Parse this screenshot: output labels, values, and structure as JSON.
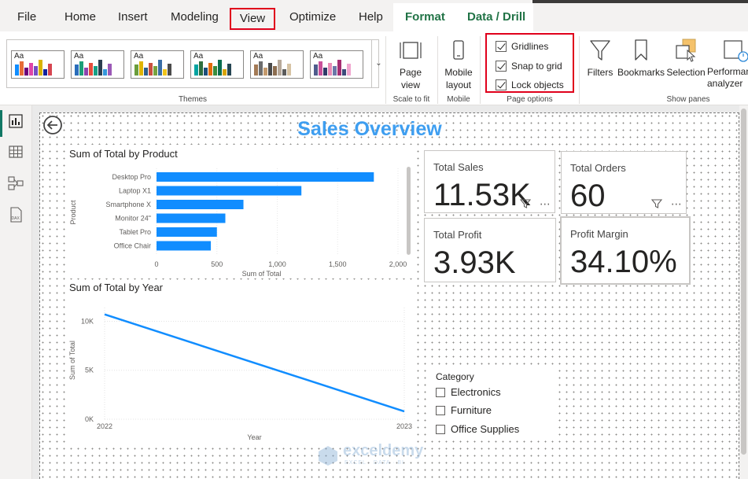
{
  "menu": {
    "file": "File",
    "home": "Home",
    "insert": "Insert",
    "modeling": "Modeling",
    "view": "View",
    "optimize": "Optimize",
    "help": "Help",
    "format": "Format",
    "data_drill": "Data / Drill"
  },
  "ribbon": {
    "themes_label": "Themes",
    "theme_sample": "Aa",
    "themes": [
      {
        "colors": [
          "#118dff",
          "#e66c37",
          "#6b007b",
          "#e044a7",
          "#744ec2",
          "#d9b300",
          "#12239e",
          "#d64550"
        ]
      },
      {
        "colors": [
          "#2a6ebb",
          "#1b9e77",
          "#8e44ad",
          "#e74c3c",
          "#16a085",
          "#2c3e50",
          "#3498db",
          "#9b59b6"
        ]
      },
      {
        "colors": [
          "#6b9e3c",
          "#e0b400",
          "#2d5f8b",
          "#c94f3f",
          "#77a33f",
          "#3a6ea5",
          "#f0c419",
          "#4b4b4b"
        ]
      },
      {
        "colors": [
          "#00a3a1",
          "#2f6f3e",
          "#1f4e79",
          "#e46c0a",
          "#3b8d3e",
          "#0b6e4f",
          "#d9a400",
          "#264653"
        ]
      },
      {
        "colors": [
          "#a37a55",
          "#6d6d6d",
          "#c49a6c",
          "#4a4a4a",
          "#8c6d4f",
          "#b7a99a",
          "#5b5b5b",
          "#d6c3a3"
        ]
      },
      {
        "colors": [
          "#4f5b8c",
          "#c9519b",
          "#2e3a67",
          "#e98ab6",
          "#6b77a8",
          "#a62e73",
          "#3d4a7a",
          "#f0a6cf"
        ]
      }
    ],
    "page_view": "Page view",
    "scale_to_fit": "Scale to fit",
    "mobile_layout": "Mobile layout",
    "mobile_label": "Mobile",
    "gridlines": "Gridlines",
    "snap_to_grid": "Snap to grid",
    "lock_objects": "Lock objects",
    "page_options_label": "Page options",
    "filters": "Filters",
    "bookmarks": "Bookmarks",
    "selection": "Selection",
    "performance": "Performance analyzer",
    "show_panes_label": "Show panes"
  },
  "report": {
    "title": "Sales Overview",
    "cards": [
      {
        "caption": "Total Sales",
        "value": "11.53K"
      },
      {
        "caption": "Total Orders",
        "value": "60"
      },
      {
        "caption": "Total Profit",
        "value": "3.93K"
      },
      {
        "caption": "Profit Margin",
        "value": "34.10%"
      }
    ],
    "slicer": {
      "title": "Category",
      "items": [
        "Electronics",
        "Furniture",
        "Office Supplies"
      ]
    },
    "watermark": {
      "name": "exceldemy",
      "tag": "EXCEL · DATA · BI"
    }
  },
  "chart_data": [
    {
      "type": "bar",
      "orientation": "horizontal",
      "title": "Sum of Total by Product",
      "categories": [
        "Desktop Pro",
        "Laptop X1",
        "Smartphone X",
        "Monitor 24\"",
        "Tablet Pro",
        "Office Chair"
      ],
      "values": [
        1800,
        1200,
        720,
        570,
        500,
        450
      ],
      "xlabel": "Sum of Total",
      "ylabel": "Product",
      "xlim": [
        0,
        2000
      ],
      "xticks": [
        "0",
        "500",
        "1,000",
        "1,500",
        "2,000"
      ],
      "xtick_values": [
        0,
        500,
        1000,
        1500,
        2000
      ],
      "color": "#118dff"
    },
    {
      "type": "line",
      "title": "Sum of Total by Year",
      "x": [
        "2022",
        "2023"
      ],
      "values": [
        10700,
        800
      ],
      "xlabel": "Year",
      "ylabel": "Sum of Total",
      "ylim": [
        0,
        11000
      ],
      "yticks": [
        "0K",
        "5K",
        "10K"
      ],
      "ytick_values": [
        0,
        5000,
        10000
      ],
      "color": "#118dff",
      "grid": true
    }
  ]
}
